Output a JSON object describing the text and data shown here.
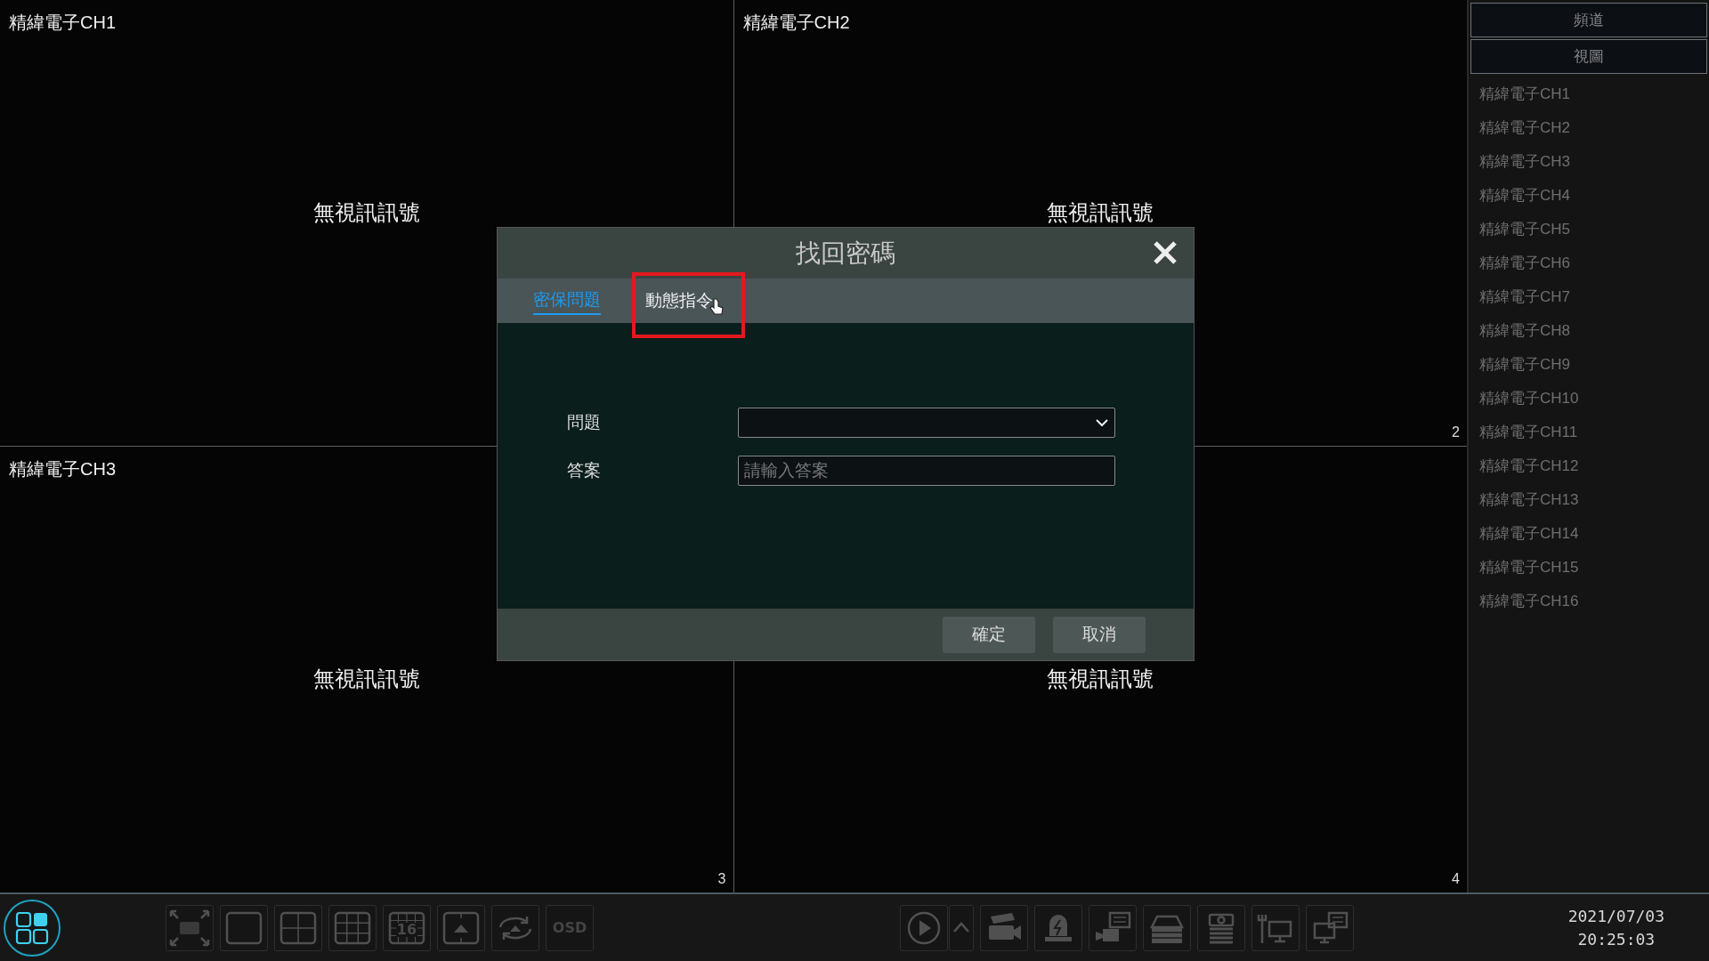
{
  "tiles": [
    {
      "title": "精緯電子CH1",
      "status": "無視訊訊號"
    },
    {
      "title": "精緯電子CH2",
      "status": "無視訊訊號",
      "number": "2"
    },
    {
      "title": "精緯電子CH3",
      "status": "無視訊訊號",
      "number": "3"
    },
    {
      "status": "無視訊訊號",
      "number": "4"
    }
  ],
  "sidebar": {
    "tabs": [
      "頻道",
      "視圖"
    ],
    "channels": [
      "精緯電子CH1",
      "精緯電子CH2",
      "精緯電子CH3",
      "精緯電子CH4",
      "精緯電子CH5",
      "精緯電子CH6",
      "精緯電子CH7",
      "精緯電子CH8",
      "精緯電子CH9",
      "精緯電子CH10",
      "精緯電子CH11",
      "精緯電子CH12",
      "精緯電子CH13",
      "精緯電子CH14",
      "精緯電子CH15",
      "精緯電子CH16"
    ]
  },
  "dialog": {
    "title": "找回密碼",
    "tabs": [
      {
        "label": "密保問題",
        "selected": true
      },
      {
        "label": "動態指令",
        "selected": false,
        "highlighted": true,
        "hovered": true
      }
    ],
    "fields": [
      {
        "kind": "select",
        "label": "問題"
      },
      {
        "kind": "text",
        "label": "答案",
        "placeholder": "請輸入答案"
      }
    ],
    "buttons": [
      "確定",
      "取消"
    ]
  },
  "toolbar": {
    "left": [
      {
        "kind": "fullscreen"
      },
      {
        "kind": "single"
      },
      {
        "kind": "quad"
      },
      {
        "kind": "nine"
      },
      {
        "kind": "sixteen",
        "label": "16"
      },
      {
        "kind": "sequence"
      },
      {
        "kind": "rotate"
      },
      {
        "kind": "osd",
        "label": "OSD"
      }
    ],
    "right": [
      {
        "kind": "play"
      },
      {
        "kind": "caret"
      },
      {
        "kind": "camera"
      },
      {
        "kind": "alarm"
      },
      {
        "kind": "camera-list"
      },
      {
        "kind": "tray"
      },
      {
        "kind": "disk"
      },
      {
        "kind": "network"
      },
      {
        "kind": "monitor"
      }
    ],
    "date": "2021/07/03",
    "time": "20:25:03"
  }
}
